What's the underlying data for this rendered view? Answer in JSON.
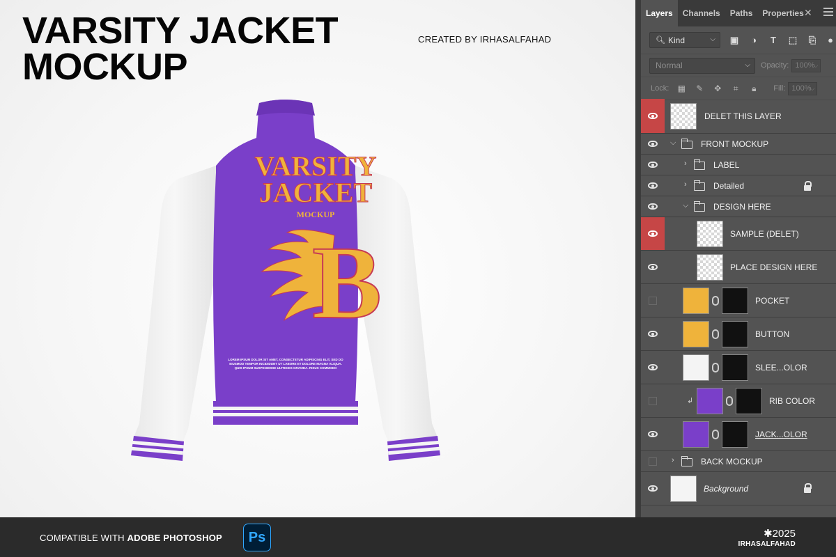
{
  "canvas": {
    "title_line1": "VARSITY JACKET",
    "title_line2": "MOCKUP",
    "creator": "CREATED BY IRHASALFAHAD",
    "jacket": {
      "back_text_1": "VARSITY",
      "back_text_2": "JACKET",
      "back_text_3": "MOCKUP",
      "back_letter": "B",
      "fine_print_1": "LOREM IPSUM DOLOR SIT AMET, CONSECTETUR ADIPISCING ELIT, SED DO",
      "fine_print_2": "EIUSMOD TEMPOR INCIDIDUNT UT LABORE ET DOLORE MAGNA ALIQUA.",
      "fine_print_3": "QUIS IPSUM SUSPENDISSE ULTRICES GRAVIDA. RISUS COMMODO",
      "colors": {
        "body": "#7a3fc9",
        "sleeve": "#f3f3f3",
        "accent": "#efb33b",
        "shadow": "#c63a55"
      }
    }
  },
  "panel": {
    "tabs": [
      "Layers",
      "Channels",
      "Paths",
      "Properties"
    ],
    "filter": {
      "label": "Kind"
    },
    "blend_mode": "Normal",
    "opacity_label": "Opacity:",
    "opacity_value": "100%",
    "lock_label": "Lock:",
    "fill_label": "Fill:",
    "fill_value": "100%",
    "layers": [
      {
        "name": "DELET THIS LAYER"
      },
      {
        "name": "FRONT MOCKUP"
      },
      {
        "name": "LABEL"
      },
      {
        "name": "Detailed"
      },
      {
        "name": "DESIGN HERE"
      },
      {
        "name": "SAMPLE (DELET)"
      },
      {
        "name": "PLACE DESIGN HERE"
      },
      {
        "name": "POCKET"
      },
      {
        "name": "BUTTON"
      },
      {
        "name": "SLEE...OLOR"
      },
      {
        "name": "RIB COLOR"
      },
      {
        "name": "JACK...OLOR"
      },
      {
        "name": "BACK MOCKUP"
      },
      {
        "name": "Background"
      }
    ]
  },
  "footer": {
    "compat_prefix": "COMPATIBLE WITH ",
    "compat_app": "ADOBE PHOTOSHOP",
    "ps_badge": "Ps",
    "year": "✱2025",
    "brand": "IRHASALFAHAD"
  }
}
